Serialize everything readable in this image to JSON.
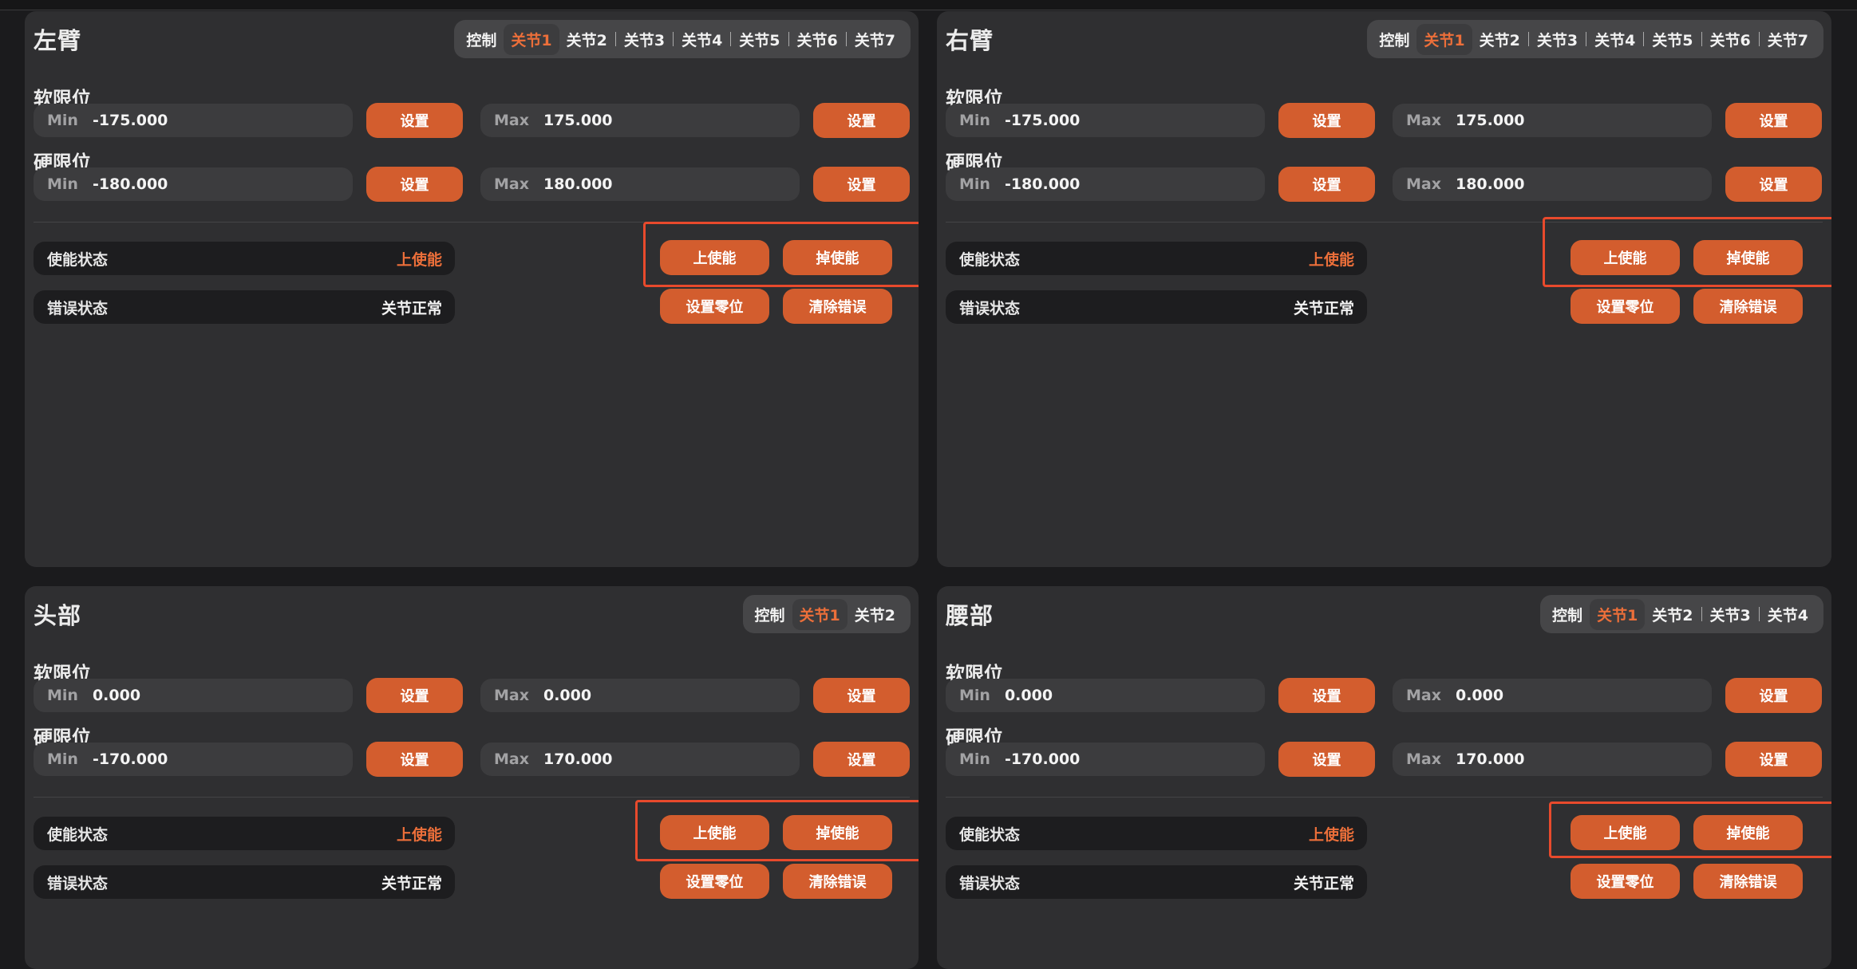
{
  "panels": [
    {
      "title": "左臂",
      "tabs": [
        "控制",
        "关节1",
        "关节2",
        "关节3",
        "关节4",
        "关节5",
        "关节6",
        "关节7"
      ],
      "soft_label": "软限位",
      "hard_label": "硬限位",
      "soft_min": "-175.000",
      "soft_max": "175.000",
      "hard_min": "-180.000",
      "hard_max": "180.000",
      "enable_label": "使能状态",
      "enable_value": "上使能",
      "error_label": "错误状态",
      "error_value": "关节正常"
    },
    {
      "title": "右臂",
      "tabs": [
        "控制",
        "关节1",
        "关节2",
        "关节3",
        "关节4",
        "关节5",
        "关节6",
        "关节7"
      ],
      "soft_label": "软限位",
      "hard_label": "硬限位",
      "soft_min": "-175.000",
      "soft_max": "175.000",
      "hard_min": "-180.000",
      "hard_max": "180.000",
      "enable_label": "使能状态",
      "enable_value": "上使能",
      "error_label": "错误状态",
      "error_value": "关节正常"
    },
    {
      "title": "头部",
      "tabs": [
        "控制",
        "关节1",
        "关节2"
      ],
      "soft_label": "软限位",
      "hard_label": "硬限位",
      "soft_min": "0.000",
      "soft_max": "0.000",
      "hard_min": "-170.000",
      "hard_max": "170.000",
      "enable_label": "使能状态",
      "enable_value": "上使能",
      "error_label": "错误状态",
      "error_value": "关节正常"
    },
    {
      "title": "腰部",
      "tabs": [
        "控制",
        "关节1",
        "关节2",
        "关节3",
        "关节4"
      ],
      "soft_label": "软限位",
      "hard_label": "硬限位",
      "soft_min": "0.000",
      "soft_max": "0.000",
      "hard_min": "-170.000",
      "hard_max": "170.000",
      "enable_label": "使能状态",
      "enable_value": "上使能",
      "error_label": "错误状态",
      "error_value": "关节正常"
    }
  ],
  "labels": {
    "min": "Min",
    "max": "Max",
    "set": "设置",
    "enable_on": "上使能",
    "enable_off": "掉使能",
    "set_zero": "设置零位",
    "clear_error": "清除错误"
  },
  "active_tab": "关节1",
  "colors": {
    "accent": "#d35d2e",
    "accent_text": "#ec6f3a",
    "highlight": "#e84a2c",
    "panel_bg": "#2f2f31"
  }
}
